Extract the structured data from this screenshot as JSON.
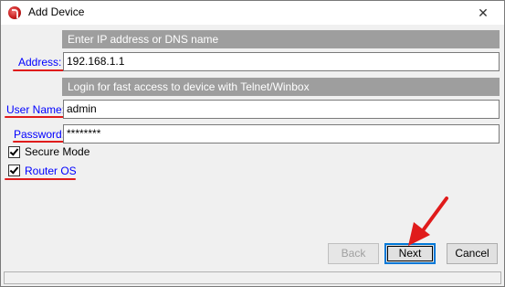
{
  "window": {
    "title": "Add Device",
    "close_glyph": "✕"
  },
  "sections": {
    "address_header": "Enter IP address or DNS name",
    "login_header": "Login for fast access to device with Telnet/Winbox"
  },
  "fields": {
    "address_label": "Address:",
    "address_value": "192.168.1.1",
    "username_label": "User Name:",
    "username_value": "admin",
    "password_label": "Password:",
    "password_value": "********"
  },
  "options": {
    "secure_mode_label": "Secure Mode",
    "secure_mode_checked": true,
    "router_os_label": "Router OS",
    "router_os_checked": true
  },
  "buttons": {
    "back": "Back",
    "next": "Next",
    "cancel": "Cancel"
  },
  "colors": {
    "annotation": "#e01b1b",
    "link_label": "#0000ff",
    "section_header": "#9e9e9e"
  },
  "icons": {
    "app": "mikrotik-winbox-icon",
    "annotation_arrow": "red-arrow-icon"
  }
}
